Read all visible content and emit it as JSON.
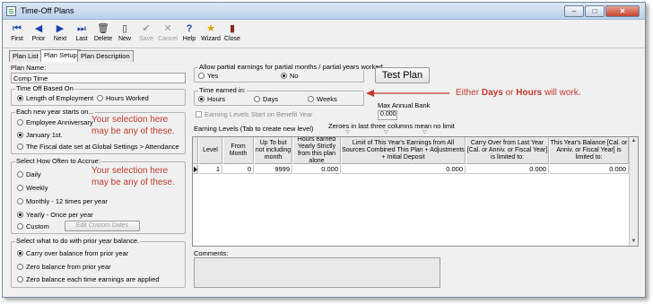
{
  "window": {
    "title": "Time-Off Plans"
  },
  "toolbar": [
    {
      "label": "First",
      "icon": "first-icon"
    },
    {
      "label": "Prior",
      "icon": "prior-icon"
    },
    {
      "label": "Next",
      "icon": "next-icon"
    },
    {
      "label": "Last",
      "icon": "last-icon"
    },
    {
      "label": "Delete",
      "icon": "trash-icon"
    },
    {
      "label": "New",
      "icon": "new-icon"
    },
    {
      "label": "Save",
      "icon": "checkmark-icon",
      "disabled": true
    },
    {
      "label": "Cancel",
      "icon": "x-icon",
      "disabled": true
    },
    {
      "label": "Help",
      "icon": "question-icon"
    },
    {
      "label": "Wizard",
      "icon": "star-icon"
    },
    {
      "label": "Close",
      "icon": "close-door-icon"
    }
  ],
  "tabs": [
    "Plan List",
    "Plan Setup",
    "Plan Description"
  ],
  "plan_name": {
    "label": "Plan Name:",
    "value": "Comp Time"
  },
  "time_off_based_on": {
    "title": "Time Off Based On",
    "options": [
      "Length of Employment",
      "Hours Worked"
    ],
    "selected": "Length of Employment"
  },
  "each_new_year": {
    "title": "Each new year starts on...",
    "options": [
      "Employee Anniversary",
      "January 1st.",
      "The Fiscal date set at Global Settings > Attendance"
    ],
    "selected": "January 1st."
  },
  "accrue": {
    "title": "Select How Often to Accrue:",
    "options": [
      "Daily",
      "Weekly",
      "Monthly - 12 times per year",
      "Yearly - Once per year",
      "Custom"
    ],
    "selected": "Yearly - Once per year",
    "custom_button": "Edit Custom Dates"
  },
  "prior_balance": {
    "title": "Select what to do with prior year balance.",
    "options": [
      "Carry over balance from prior year",
      "Zero balance from prior year",
      "Zero balance each time earnings are applied"
    ],
    "selected": "Carry over balance from prior year"
  },
  "partial": {
    "title": "Allow partial earnings for partial months / partial years worked",
    "options": [
      "Yes",
      "No"
    ],
    "selected": "No"
  },
  "test_plan_button": "Test Plan",
  "time_earned": {
    "title": "Time earned in:",
    "options": [
      "Hours",
      "Days",
      "Weeks"
    ],
    "selected": "Hours"
  },
  "earning_levels_benefit": "Earning Levels Start on Benefit Year",
  "max_annual_bank": {
    "label": "Max Annual Bank",
    "value": "0.000"
  },
  "earning_levels_label": "Earning Levels (Tab to create new level)",
  "zeroes_note": "Zeroes in last three columns mean no limit",
  "grid": {
    "columns": [
      "Level",
      "From Month",
      "Up To but not including month",
      "Hours earned Yearly Strictly from this plan alone",
      "Limit of This Year's Earnings from All Sources Combined This Plan + Adjustments + Initial Deposit",
      "Carry Over from Last Year [Cal. or Anniv. or Fiscal Year] is limited to:",
      "This Year's Balance [Cal. or Anniv. or Fiscal Year] is limited to:"
    ],
    "rows": [
      [
        "1",
        "0",
        "9999",
        "0.000",
        "0.000",
        "0.000",
        "0.000"
      ]
    ]
  },
  "comments": {
    "label": "Comments:",
    "value": ""
  },
  "annotations": {
    "note1_line1": "Your selection here",
    "note1_line2": "may be any of these.",
    "note2_line1": "Your selection here",
    "note2_line2": "may be any of these.",
    "note3_pre": "Either ",
    "note3_days": "Days",
    "note3_mid": " or ",
    "note3_hours": "Hours",
    "note3_post": " will work.",
    "color": "#c0392b"
  }
}
